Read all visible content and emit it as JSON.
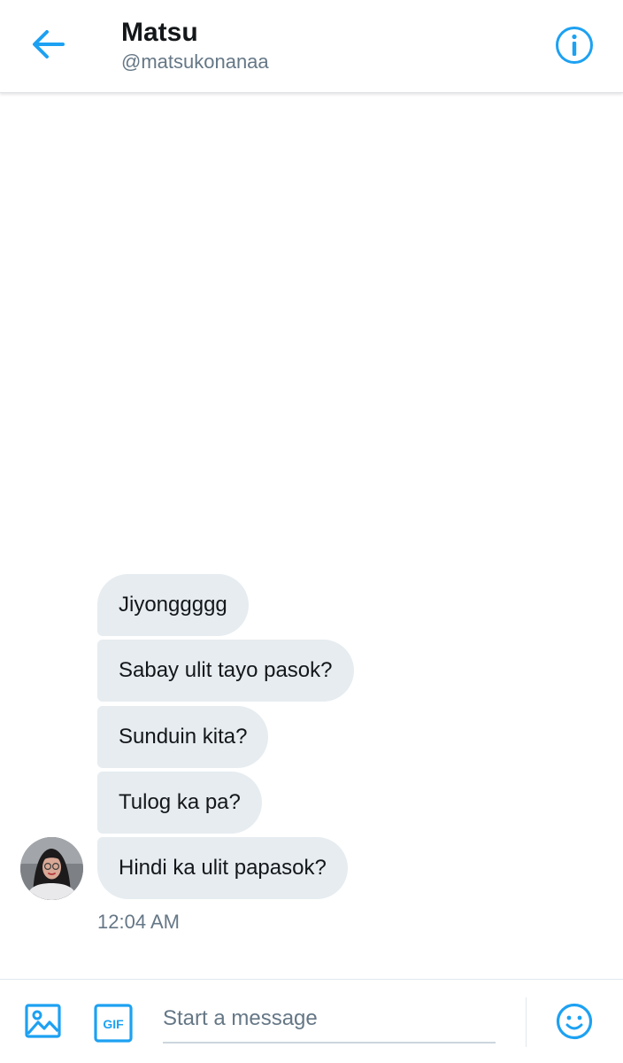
{
  "header": {
    "name": "Matsu",
    "handle": "@matsukonanaa"
  },
  "icons": {
    "back": "arrow-left-icon",
    "info": "info-icon",
    "media": "image-icon",
    "gif": "gif-icon",
    "emoji": "smiley-icon"
  },
  "gif_label": "GIF",
  "messages": [
    {
      "text": "Jiyonggggg"
    },
    {
      "text": "Sabay ulit tayo pasok?"
    },
    {
      "text": "Sunduin kita?"
    },
    {
      "text": "Tulog ka pa?"
    },
    {
      "text": "Hindi ka ulit papasok?"
    }
  ],
  "timestamp": "12:04 AM",
  "composer": {
    "placeholder": "Start a message"
  },
  "colors": {
    "accent": "#1da1f2",
    "bubble": "#e6ecf0",
    "text": "#14171a",
    "secondary": "#657786"
  }
}
